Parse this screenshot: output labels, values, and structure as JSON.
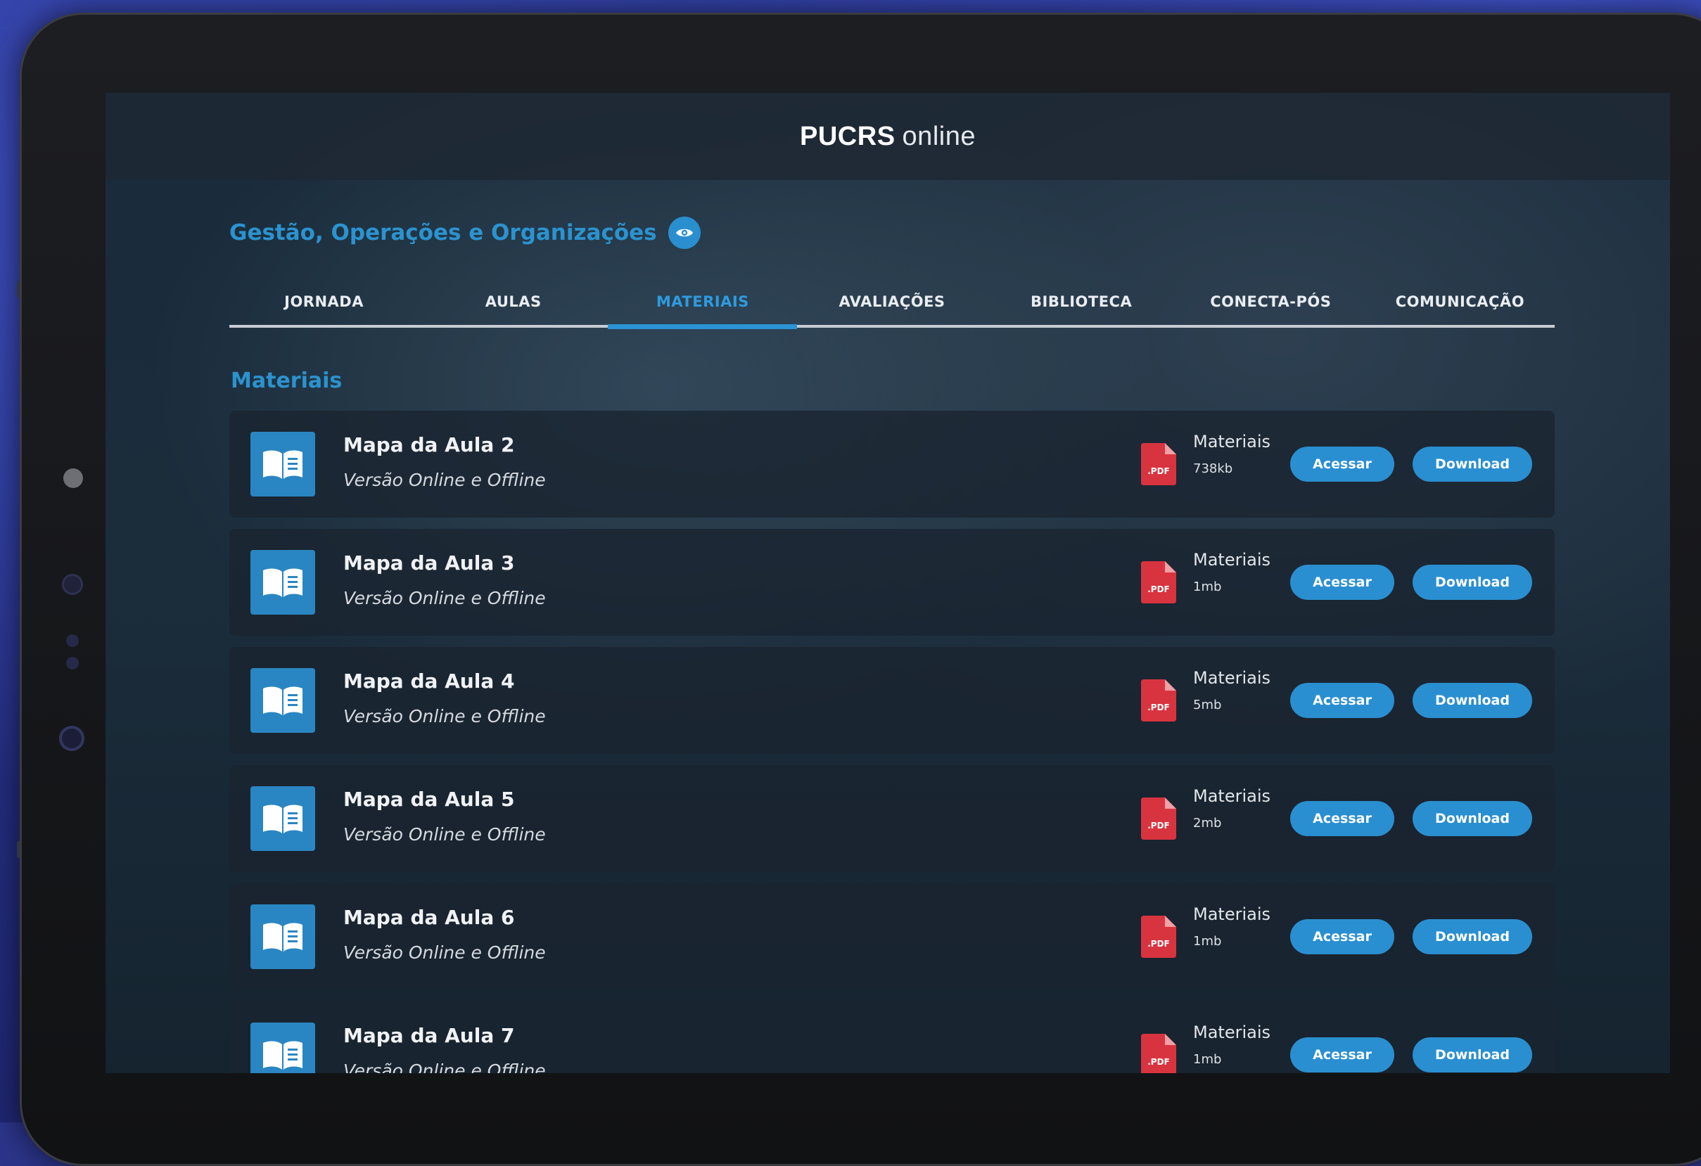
{
  "header": {
    "logo_strong": "PUCRS",
    "logo_light": "online"
  },
  "course": {
    "title": "Gestão, Operações e Organizações"
  },
  "tabs": [
    {
      "label": "JORNADA",
      "active": false
    },
    {
      "label": "AULAS",
      "active": false
    },
    {
      "label": "MATERIAIS",
      "active": true
    },
    {
      "label": "AVALIAÇÕES",
      "active": false
    },
    {
      "label": "BIBLIOTECA",
      "active": false
    },
    {
      "label": "CONECTA-PÓS",
      "active": false
    },
    {
      "label": "COMUNICAÇÃO",
      "active": false
    }
  ],
  "section": {
    "title": "Materiais"
  },
  "materials": [
    {
      "title": "Mapa da Aula 2",
      "subtitle": "Versão Online e Offline",
      "file_label": "Materiais",
      "size": "738kb",
      "access_label": "Acessar",
      "download_label": "Download",
      "file_type": ".PDF"
    },
    {
      "title": "Mapa da Aula 3",
      "subtitle": "Versão Online e Offline",
      "file_label": "Materiais",
      "size": "1mb",
      "access_label": "Acessar",
      "download_label": "Download",
      "file_type": ".PDF"
    },
    {
      "title": "Mapa da Aula 4",
      "subtitle": "Versão Online e Offline",
      "file_label": "Materiais",
      "size": "5mb",
      "access_label": "Acessar",
      "download_label": "Download",
      "file_type": ".PDF"
    },
    {
      "title": "Mapa da Aula 5",
      "subtitle": "Versão Online e Offline",
      "file_label": "Materiais",
      "size": "2mb",
      "access_label": "Acessar",
      "download_label": "Download",
      "file_type": ".PDF"
    },
    {
      "title": "Mapa da Aula 6",
      "subtitle": "Versão Online e Offline",
      "file_label": "Materiais",
      "size": "1mb",
      "access_label": "Acessar",
      "download_label": "Download",
      "file_type": ".PDF"
    },
    {
      "title": "Mapa da Aula 7",
      "subtitle": "Versão Online e Offline",
      "file_label": "Materiais",
      "size": "1mb",
      "access_label": "Acessar",
      "download_label": "Download",
      "file_type": ".PDF"
    }
  ],
  "colors": {
    "accent": "#2b93cf",
    "pdf": "#d8343f"
  },
  "icons": {
    "course_badge": "eye-icon",
    "material": "book-icon",
    "file": "pdf-file-icon"
  }
}
